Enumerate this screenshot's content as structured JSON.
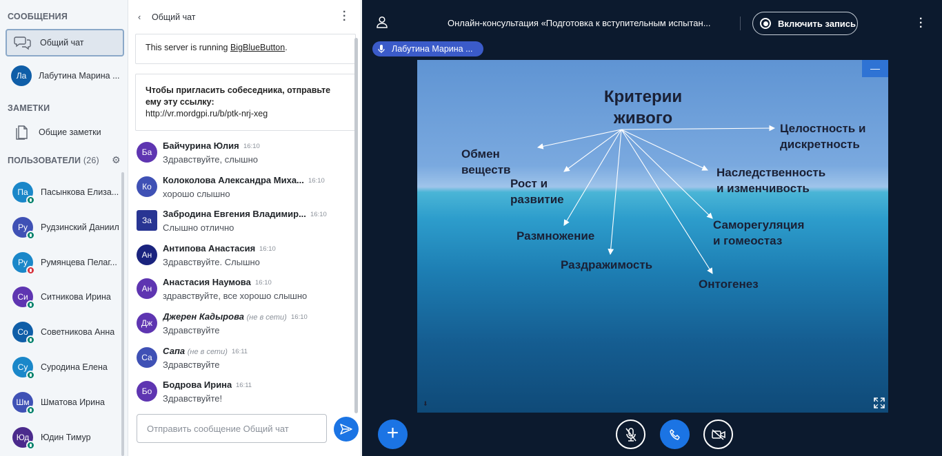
{
  "sidebar": {
    "messages_title": "СООБЩЕНИЯ",
    "public_chat_label": "Общий чат",
    "private_chat": {
      "initials": "Ла",
      "name": "Лабутина Марина ...",
      "color": "#0f5ea8"
    },
    "notes_title": "ЗАМЕТКИ",
    "shared_notes_label": "Общие заметки",
    "users_title": "ПОЛЬЗОВАТЕЛИ",
    "users_count": "(26)",
    "users": [
      {
        "initials": "Па",
        "name": "Пасынкова Елиза...",
        "color": "#1a87c9",
        "muted": false
      },
      {
        "initials": "Ру",
        "name": "Рудзинский Даниил",
        "color": "#3f51b5",
        "muted": false
      },
      {
        "initials": "Ру",
        "name": "Румянцева Пелаг...",
        "color": "#1a87c9",
        "muted": true
      },
      {
        "initials": "Си",
        "name": "Ситникова Ирина",
        "color": "#5e35b1",
        "muted": false
      },
      {
        "initials": "Со",
        "name": "Советникова Анна",
        "color": "#0f5ea8",
        "muted": false
      },
      {
        "initials": "Су",
        "name": "Суродина Елена",
        "color": "#1a87c9",
        "muted": false
      },
      {
        "initials": "Шм",
        "name": "Шматова Ирина",
        "color": "#3f51b5",
        "muted": false
      },
      {
        "initials": "Юд",
        "name": "Юдин Тимур",
        "color": "#4b2a8c",
        "muted": false
      }
    ]
  },
  "chat": {
    "title": "Общий чат",
    "server_prefix": "This server is running ",
    "server_link": "BigBlueButton",
    "server_suffix": ".",
    "invite_text": "Чтобы пригласить собеседника, отправьте ему эту ссылку:",
    "invite_link": "http://vr.mordgpi.ru/b/ptk-nrj-xeg",
    "messages": [
      {
        "initials": "Ба",
        "color": "#5e35b1",
        "square": false,
        "name": "Байчурина Юлия",
        "offline": "",
        "time": "16:10",
        "text": "Здравствуйте, слышно"
      },
      {
        "initials": "Ко",
        "color": "#3f51b5",
        "square": false,
        "name": "Колоколова Александра Миха...",
        "offline": "",
        "time": "16:10",
        "text": "хорошо слышно"
      },
      {
        "initials": "За",
        "color": "#283593",
        "square": true,
        "name": "Забродина Евгения Владимир...",
        "offline": "",
        "time": "16:10",
        "text": "Слышно отлично"
      },
      {
        "initials": "Ан",
        "color": "#1a237e",
        "square": false,
        "name": "Антипова Анастасия",
        "offline": "",
        "time": "16:10",
        "text": "Здравствуйте. Слышно"
      },
      {
        "initials": "Ан",
        "color": "#5e35b1",
        "square": false,
        "name": "Анастасия Наумова",
        "offline": "",
        "time": "16:10",
        "text": "здравствуйте, все хорошо слышно"
      },
      {
        "initials": "Дж",
        "color": "#5e35b1",
        "square": false,
        "name": "Джерен Кадырова",
        "offline": "(не в сети)",
        "time": "16:10",
        "text": "Здравствуйте"
      },
      {
        "initials": "Са",
        "color": "#3f51b5",
        "square": false,
        "name": "Сапа",
        "offline": "(не в сети)",
        "time": "16:11",
        "text": "Здравствуйте"
      },
      {
        "initials": "Бо",
        "color": "#5e35b1",
        "square": false,
        "name": "Бодрова Ирина",
        "offline": "",
        "time": "16:11",
        "text": "Здравствуйте!"
      }
    ],
    "input_placeholder": "Отправить сообщение Общий чат"
  },
  "main": {
    "meeting_title": "Онлайн-консультация «Подготовка к вступительным испытан...",
    "record_label": "Включить запись",
    "talking_user": "Лабутина Марина ...",
    "colors": {
      "accent": "#1b74e4",
      "background": "#0c1a2e",
      "talker": "#3b5bc9"
    }
  },
  "slide": {
    "title_line1": "Критерии",
    "title_line2": "живого",
    "items": [
      {
        "line1": "Целостность и",
        "line2": "дискретность"
      },
      {
        "line1": "Обмен",
        "line2": "веществ"
      },
      {
        "line1": "Рост и",
        "line2": "развитие"
      },
      {
        "line1": "Наследственность",
        "line2": "и изменчивость"
      },
      {
        "line1": "Размножение",
        "line2": ""
      },
      {
        "line1": "Саморегуляция",
        "line2": "и гомеостаз"
      },
      {
        "line1": "Раздражимость",
        "line2": ""
      },
      {
        "line1": "Онтогенез",
        "line2": ""
      }
    ]
  }
}
